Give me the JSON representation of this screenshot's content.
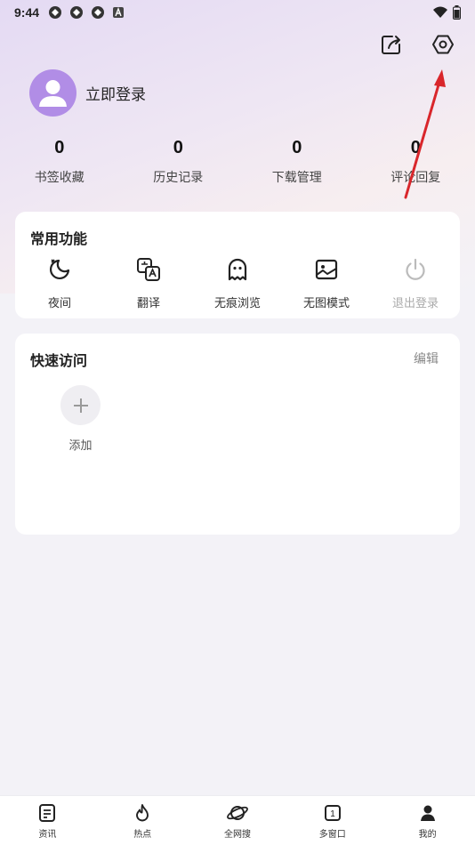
{
  "status": {
    "time": "9:44"
  },
  "profile": {
    "login_text": "立即登录"
  },
  "stats": [
    {
      "value": "0",
      "label": "书签收藏"
    },
    {
      "value": "0",
      "label": "历史记录"
    },
    {
      "value": "0",
      "label": "下载管理"
    },
    {
      "value": "0",
      "label": "评论回复"
    }
  ],
  "functions": {
    "title": "常用功能",
    "items": [
      {
        "label": "夜间",
        "icon": "moon-icon"
      },
      {
        "label": "翻译",
        "icon": "translate-icon"
      },
      {
        "label": "无痕浏览",
        "icon": "ghost-icon"
      },
      {
        "label": "无图模式",
        "icon": "image-icon"
      },
      {
        "label": "退出登录",
        "icon": "power-icon"
      }
    ]
  },
  "quick_access": {
    "title": "快速访问",
    "edit_label": "编辑",
    "add_label": "添加"
  },
  "bottom_nav": [
    {
      "label": "资讯",
      "icon": "news-icon"
    },
    {
      "label": "热点",
      "icon": "flame-icon"
    },
    {
      "label": "全网搜",
      "icon": "planet-icon"
    },
    {
      "label": "多窗口",
      "icon": "windows-icon",
      "badge": "1"
    },
    {
      "label": "我的",
      "icon": "person-icon"
    }
  ],
  "colors": {
    "accent": "#b18de6",
    "arrow": "#d9262b"
  }
}
